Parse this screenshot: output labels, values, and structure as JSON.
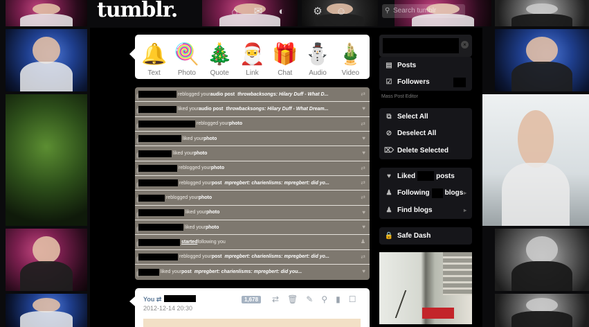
{
  "header": {
    "logo_text": "tumblr.",
    "nav_icons": [
      "home-icon",
      "mail-icon",
      "compass-icon",
      "gear-icon",
      "user-icon"
    ],
    "search_placeholder": "Search tumblr"
  },
  "composer": {
    "post_types": [
      {
        "label": "Text",
        "icon": "bell-icon",
        "glyph": "🔔"
      },
      {
        "label": "Photo",
        "icon": "candy-cane-icon",
        "glyph": "🍭"
      },
      {
        "label": "Quote",
        "icon": "christmas-tree-icon",
        "glyph": "🎄"
      },
      {
        "label": "Link",
        "icon": "santa-icon",
        "glyph": "🎅"
      },
      {
        "label": "Chat",
        "icon": "gift-icon",
        "glyph": "🎁"
      },
      {
        "label": "Audio",
        "icon": "snowman-icon",
        "glyph": "⛄"
      },
      {
        "label": "Video",
        "icon": "wreath-icon",
        "glyph": "🎍"
      }
    ]
  },
  "notifications": [
    {
      "pre": "reblogged your",
      "obj": "audio post",
      "quote": "throwbacksongs: Hilary Duff - What D...",
      "icon": "reblog",
      "redact": 55
    },
    {
      "pre": "liked your",
      "obj": "audio post",
      "quote": "throwbacksongs: Hilary Duff - What Dream...",
      "icon": "heart",
      "redact": 55
    },
    {
      "pre": "reblogged your",
      "obj": "photo",
      "quote": "",
      "icon": "reblog",
      "redact": 82
    },
    {
      "pre": "liked your",
      "obj": "photo",
      "quote": "",
      "icon": "heart",
      "redact": 62
    },
    {
      "pre": "liked your",
      "obj": "photo",
      "quote": "",
      "icon": "heart",
      "redact": 48
    },
    {
      "pre": "reblogged your",
      "obj": "photo",
      "quote": "",
      "icon": "reblog",
      "redact": 56
    },
    {
      "pre": "reblogged your",
      "obj": "post",
      "quote": "mpregbert: charienlisms: mpregbert: did yo...",
      "icon": "reblog",
      "redact": 57
    },
    {
      "pre": "reblogged your",
      "obj": "photo",
      "quote": "",
      "icon": "reblog",
      "redact": 38
    },
    {
      "pre": "liked your",
      "obj": "photo",
      "quote": "",
      "icon": "heart",
      "redact": 66
    },
    {
      "pre": "liked your",
      "obj": "photo",
      "quote": "",
      "icon": "heart",
      "redact": 65
    },
    {
      "pre": "started",
      "obj": "following you",
      "quote": "",
      "icon": "user",
      "redact": 60,
      "follow": true
    },
    {
      "pre": "reblogged your",
      "obj": "post",
      "quote": "mpregbert: charienlisms: mpregbert: did yo...",
      "icon": "reblog",
      "redact": 57
    },
    {
      "pre": "liked your",
      "obj": "post",
      "quote": "mpregbert: charienlisms: mpregbert: did you...",
      "icon": "heart",
      "redact": 30
    }
  ],
  "my_post": {
    "you_label": "You",
    "date": "2012-12-14 20:30",
    "notes_count": "1,678",
    "tools": [
      "reblog-icon",
      "delete-icon",
      "edit-icon",
      "search-icon",
      "bookmark-icon",
      "checkbox-icon"
    ]
  },
  "sidebar": {
    "posts_label": "Posts",
    "followers_label": "Followers",
    "mass_post_editor": "Mass Post Editor",
    "select_all": "Select All",
    "deselect_all": "Deselect All",
    "delete_selected": "Delete Selected",
    "liked_pre": "Liked",
    "liked_post": "posts",
    "following_pre": "Following",
    "following_post": "blogs",
    "find_blogs": "Find blogs",
    "safe_dash": "Safe Dash"
  },
  "colors": {
    "notifications_bg": "#7e786f",
    "page_bg": "#0b0b0d",
    "accent_count": "#a6b3c2"
  }
}
